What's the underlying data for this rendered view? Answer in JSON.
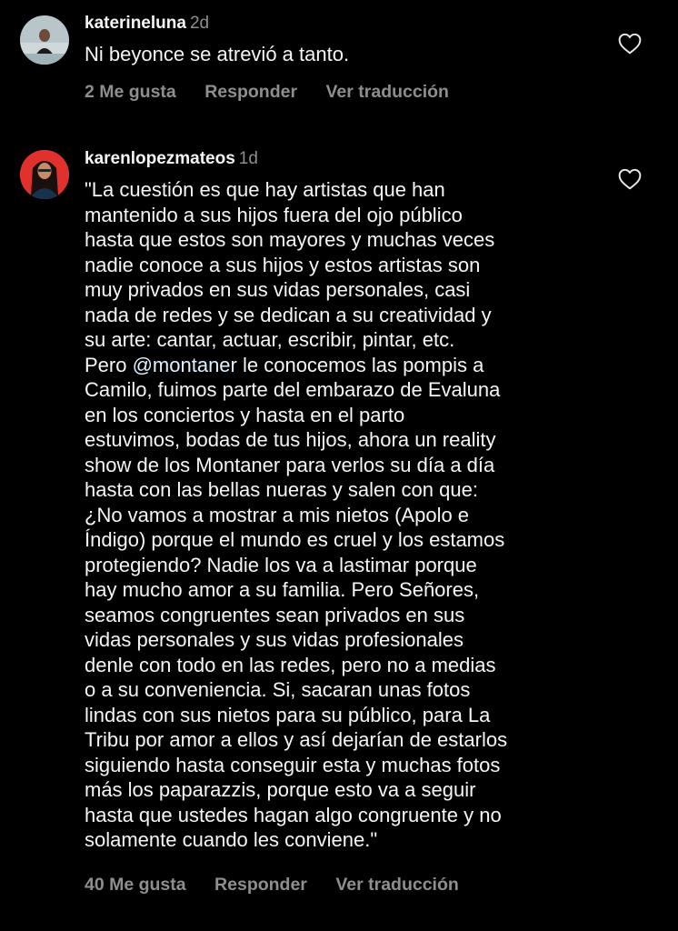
{
  "comments": [
    {
      "username": "katerineluna",
      "time": "2d",
      "lines": [
        "Ni beyonce se atrevió a tanto."
      ],
      "likes": "2 Me gusta",
      "reply": "Responder",
      "translate": "Ver traducción"
    },
    {
      "username": "karenlopezmateos",
      "time": "1d",
      "text_before_mention": "Pero ",
      "mention": "@montaner",
      "text_after_mention": " le conocemos las pompis a",
      "lines": [
        "\"La cuestión es que hay artistas que han",
        "mantenido a sus hijos fuera del ojo público",
        "hasta que estos son mayores y muchas veces",
        "nadie conoce a sus hijos y estos artistas son",
        "muy privados en sus vidas personales, casi",
        "nada de redes y se dedican a su creatividad y",
        "su arte: cantar, actuar, escribir, pintar, etc.",
        "Camilo, fuimos parte del embarazo de Evaluna",
        "en los conciertos y hasta en el parto",
        "estuvimos, bodas de tus hijos, ahora un reality",
        "show de los Montaner para verlos su día a día",
        "hasta con las bellas nueras y salen con que:",
        "¿No vamos a mostrar a mis nietos (Apolo e",
        "Índigo) porque el mundo es cruel y los estamos",
        "protegiendo? Nadie los va a lastimar porque",
        "hay mucho amor a su familia.  Pero Señores,",
        "seamos congruentes sean privados en sus",
        "vidas personales y sus vidas profesionales",
        "denle con todo en las redes, pero no a medias",
        "o a su conveniencia. Si, sacaran unas fotos",
        "lindas con sus nietos para su público, para La",
        "Tribu por amor a ellos y así dejarían de estarlos",
        "siguiendo hasta conseguir esta y muchas fotos",
        "más los paparazzis, porque esto va a seguir",
        "hasta que ustedes hagan algo congruente y no",
        "solamente cuando les conviene.\""
      ],
      "likes": "40 Me gusta",
      "reply": "Responder",
      "translate": "Ver traducción"
    }
  ],
  "colors": {
    "background": "#000000",
    "text_primary": "#f5f5f5",
    "text_secondary": "#8e8e8e",
    "mention": "#e0f1ff",
    "avatar_ring_red": "#e0312d"
  },
  "icons": {
    "like": "heart-outline-icon"
  }
}
